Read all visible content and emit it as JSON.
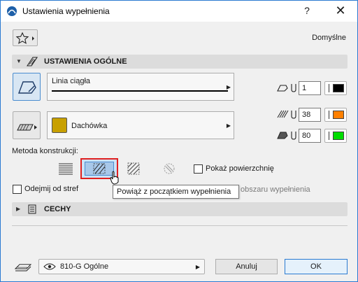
{
  "window": {
    "title": "Ustawienia wypełnienia",
    "help_label": "?",
    "close_label": "✕"
  },
  "favorites": {
    "icon": "star-icon",
    "preset_label": "Domyślne"
  },
  "general_section": {
    "title": "USTAWIENIA OGÓLNE",
    "icon": "fill-settings-icon"
  },
  "line": {
    "type_name": "Linia ciągła"
  },
  "fill": {
    "type_name": "Dachówka",
    "swatch_color": "#c8a000"
  },
  "pens": [
    {
      "icon": "contour-pen-icon",
      "value": "1",
      "color": "#000000"
    },
    {
      "icon": "fill-pen-icon",
      "value": "38",
      "color": "#ff8000"
    },
    {
      "icon": "background-pen-icon",
      "value": "80",
      "color": "#00dd00"
    }
  ],
  "construction": {
    "label": "Metoda konstrukcji:",
    "show_surface_label": "Pokaż powierzchnię",
    "show_surface_checked": false,
    "subtract_label": "Odejmij od stref",
    "subtract_checked": false,
    "area_label": "obszaru wypełnienia"
  },
  "tooltip": {
    "text": "Powiąż z początkiem wypełnienia"
  },
  "props_section": {
    "title": "CECHY",
    "icon": "properties-icon"
  },
  "layer": {
    "name": "810-G Ogólne"
  },
  "buttons": {
    "cancel": "Anuluj",
    "ok": "OK"
  }
}
